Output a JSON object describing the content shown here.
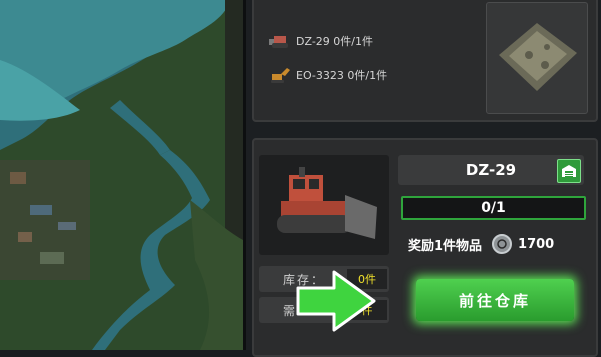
{
  "requirements": [
    {
      "icon": "bulldozer-icon",
      "label": "DZ-29 0件/1件"
    },
    {
      "icon": "excavator-icon",
      "label": "EO-3323 0件/1件"
    }
  ],
  "detail": {
    "title": "DZ-29",
    "progress": "0/1",
    "progress_fraction": 0.0,
    "reward_label": "奖励1件物品",
    "reward_amount": "1700",
    "stock_label": "库存：",
    "stock_value": "0件",
    "need_label": "需",
    "need_value": "件",
    "go_button_label": "前往仓库"
  },
  "colors": {
    "accent_green": "#2fa53c",
    "value_yellow": "#f0e12b",
    "hint_arrow": "#3fd43f"
  }
}
